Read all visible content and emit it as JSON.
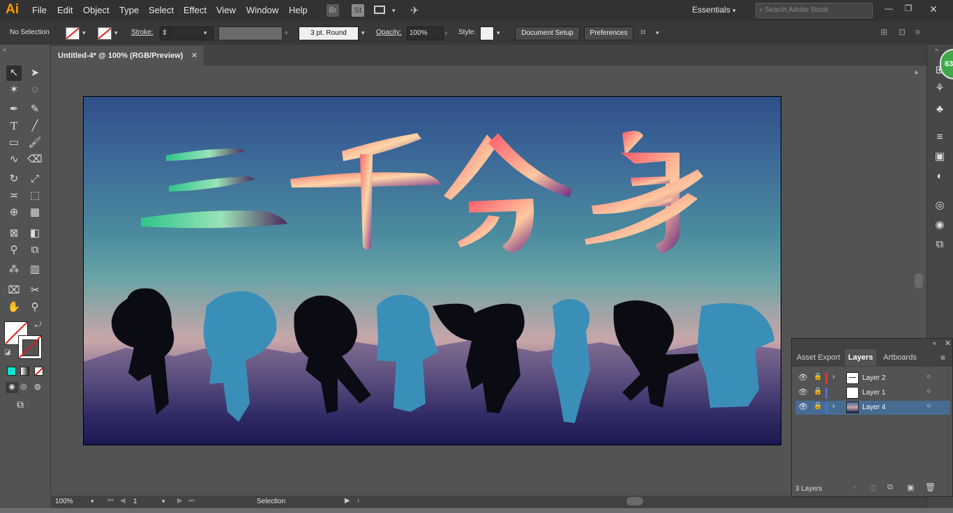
{
  "app": {
    "logo": "Ai"
  },
  "menu": [
    "File",
    "Edit",
    "Object",
    "Type",
    "Select",
    "Effect",
    "View",
    "Window",
    "Help"
  ],
  "app_icons": [
    "Br",
    "St"
  ],
  "workspace": "Essentials",
  "search": {
    "placeholder": "Search Adobe Stock"
  },
  "control": {
    "selection": "No Selection",
    "stroke_label": "Stroke:",
    "brush": "3 pt. Round",
    "opacity_label": "Opacity:",
    "opacity": "100%",
    "style_label": "Style:",
    "document_setup": "Document Setup",
    "preferences": "Preferences"
  },
  "document": {
    "tab": "Untitled-4* @ 100% (RGB/Preview)"
  },
  "artwork": {
    "title_chars": [
      "三",
      "千",
      "分",
      "身"
    ]
  },
  "status": {
    "zoom": "100%",
    "artboard": "1",
    "tool": "Selection"
  },
  "panel": {
    "tabs": [
      "Asset Export",
      "Layers",
      "Artboards"
    ],
    "active_tab": "Layers",
    "layers": [
      {
        "name": "Layer 2",
        "color": "#e0383e"
      },
      {
        "name": "Layer 1",
        "color": "#4f6fe0"
      },
      {
        "name": "Layer 4",
        "color": "#4f6fe0"
      }
    ],
    "count": "3 Layers"
  },
  "badge": "63",
  "colors": {
    "accent": "#ff9a00",
    "selected_row": "#466c92"
  }
}
